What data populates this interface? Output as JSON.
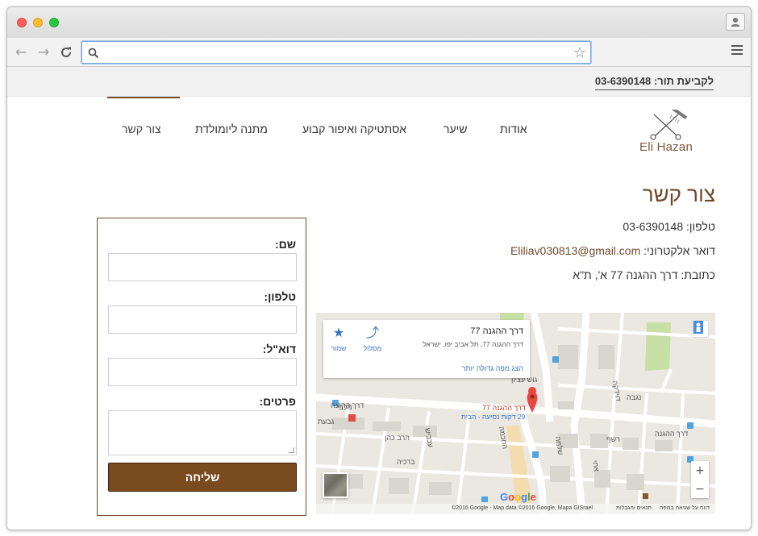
{
  "browser": {
    "url": "",
    "icons": [
      "back-arrow-icon",
      "forward-arrow-icon",
      "reload-icon",
      "search-icon",
      "star-icon",
      "menu-icon",
      "profile-icon"
    ]
  },
  "topbar": {
    "appointment": "לקביעת תור: 03-6390148"
  },
  "logo": {
    "text": "Eli Hazan"
  },
  "nav": {
    "items": [
      "צור קשר",
      "מתנה ליומולדת",
      "אסתטיקה ואיפור קבוע",
      "שיער",
      "אודות"
    ],
    "active": "צור קשר"
  },
  "page": {
    "title": "צור קשר",
    "phone_line": "טלפון: 03-6390148",
    "email_label": "דואר אלקטרוני: ",
    "email": "Eliliav030813@gmail.com",
    "address_line": "כתובת: דרך ההגנה 77 א', ת\"א"
  },
  "form": {
    "name_label": "שם:",
    "phone_label": "טלפון:",
    "email_label": "דוא\"ל:",
    "details_label": "פרטים:",
    "submit": "שליחה",
    "name_value": "",
    "phone_value": "",
    "email_value": "",
    "details_value": ""
  },
  "map": {
    "card_title": "דרך ההגנה 77",
    "card_address": "דרך ההגנה 77, תל אביב יפו, ישראל",
    "card_link": "הצג מפה גדולה יותר",
    "route_label": "מסלול",
    "save_label": "שמור",
    "pin_label": "דרך ההגנה 77",
    "pin_sub": "29 דקות נסיעה - הבית",
    "streets": [
      "דרך ההגנה",
      "דרך ההגנה",
      "נגבה",
      "גוש עציון",
      "דוידקה",
      "רשף",
      "עכביש",
      "החכמה",
      "שלמה",
      "הרב כהן",
      "ברכיה",
      "מכבי",
      "גבעת",
      "אחי"
    ],
    "zoom_in": "+",
    "zoom_out": "−",
    "google": "Google",
    "attribution": "©2016 Google - Map data ©2016 Google, Mapa GISrael",
    "terms": "תנאים והגבלות",
    "report": "דווח על שגיאה במפה"
  }
}
